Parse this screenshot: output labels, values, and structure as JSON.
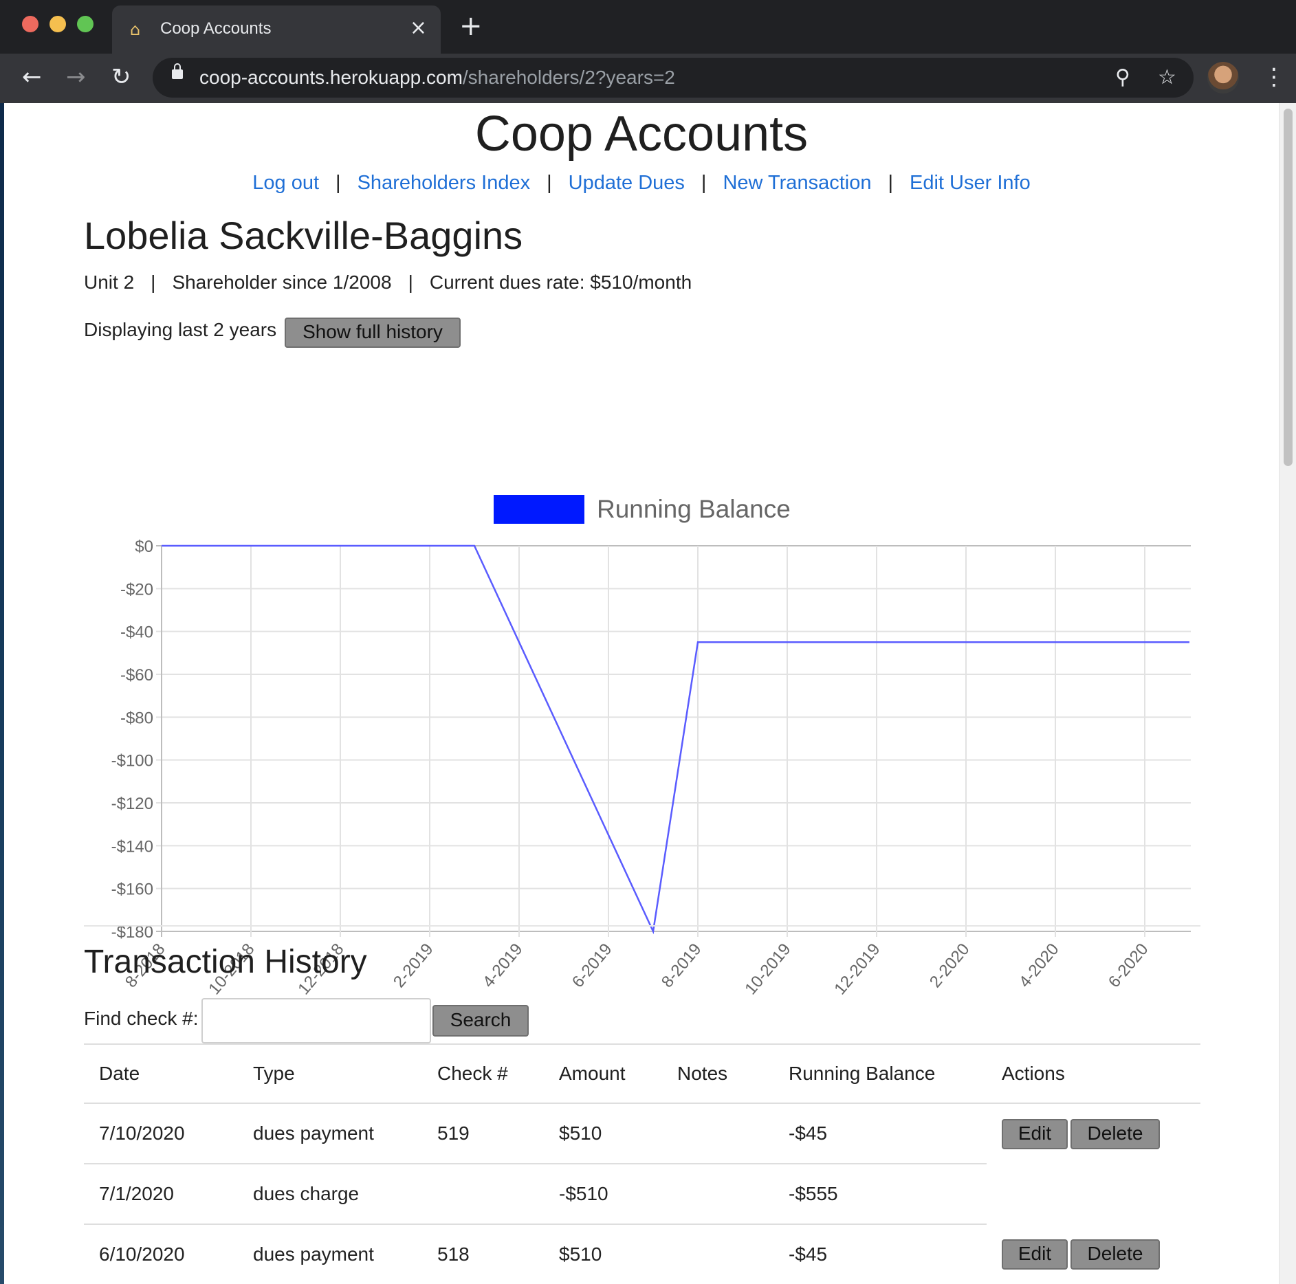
{
  "browser": {
    "tab_title": "Coop Accounts",
    "url_host": "coop-accounts.herokuapp.com",
    "url_path": "/shareholders/2?years=2"
  },
  "site": {
    "title": "Coop Accounts",
    "nav": [
      "Log out",
      "Shareholders Index",
      "Update Dues",
      "New Transaction",
      "Edit User Info"
    ]
  },
  "shareholder": {
    "name": "Lobelia Sackville-Baggins",
    "unit": "Unit 2",
    "since": "Shareholder since 1/2008",
    "dues_rate": "Current dues rate: $510/month",
    "display_text": "Displaying last 2 years",
    "full_history_label": "Show full history"
  },
  "chart_data": {
    "type": "line",
    "series": [
      {
        "name": "Running Balance",
        "color": "#0019ff",
        "points": [
          {
            "x": "2018-08",
            "y": 0
          },
          {
            "x": "2019-03",
            "y": 0
          },
          {
            "x": "2019-07",
            "y": -180
          },
          {
            "x": "2019-08",
            "y": -45
          },
          {
            "x": "2020-07",
            "y": -45
          }
        ]
      }
    ],
    "x_ticks": [
      "8-2018",
      "10-2018",
      "12-2018",
      "2-2019",
      "4-2019",
      "6-2019",
      "8-2019",
      "10-2019",
      "12-2019",
      "2-2020",
      "4-2020",
      "6-2020"
    ],
    "y_ticks": [
      "$0",
      "-$20",
      "-$40",
      "-$60",
      "-$80",
      "-$100",
      "-$120",
      "-$140",
      "-$160",
      "-$180"
    ],
    "ylim": [
      -180,
      0
    ],
    "grid": true,
    "legend": "top"
  },
  "transactions": {
    "title": "Transaction History",
    "find_label": "Find check #:",
    "find_value": "",
    "search_label": "Search",
    "columns": [
      "Date",
      "Type",
      "Check #",
      "Amount",
      "Notes",
      "Running Balance",
      "Actions"
    ],
    "edit_label": "Edit",
    "delete_label": "Delete",
    "rows": [
      {
        "date": "7/10/2020",
        "type": "dues payment",
        "check": "519",
        "amount": "$510",
        "notes": "",
        "balance": "-$45"
      },
      {
        "date": "7/1/2020",
        "type": "dues charge",
        "check": "",
        "amount": "-$510",
        "notes": "",
        "balance": "-$555"
      },
      {
        "date": "6/10/2020",
        "type": "dues payment",
        "check": "518",
        "amount": "$510",
        "notes": "",
        "balance": "-$45"
      }
    ]
  }
}
